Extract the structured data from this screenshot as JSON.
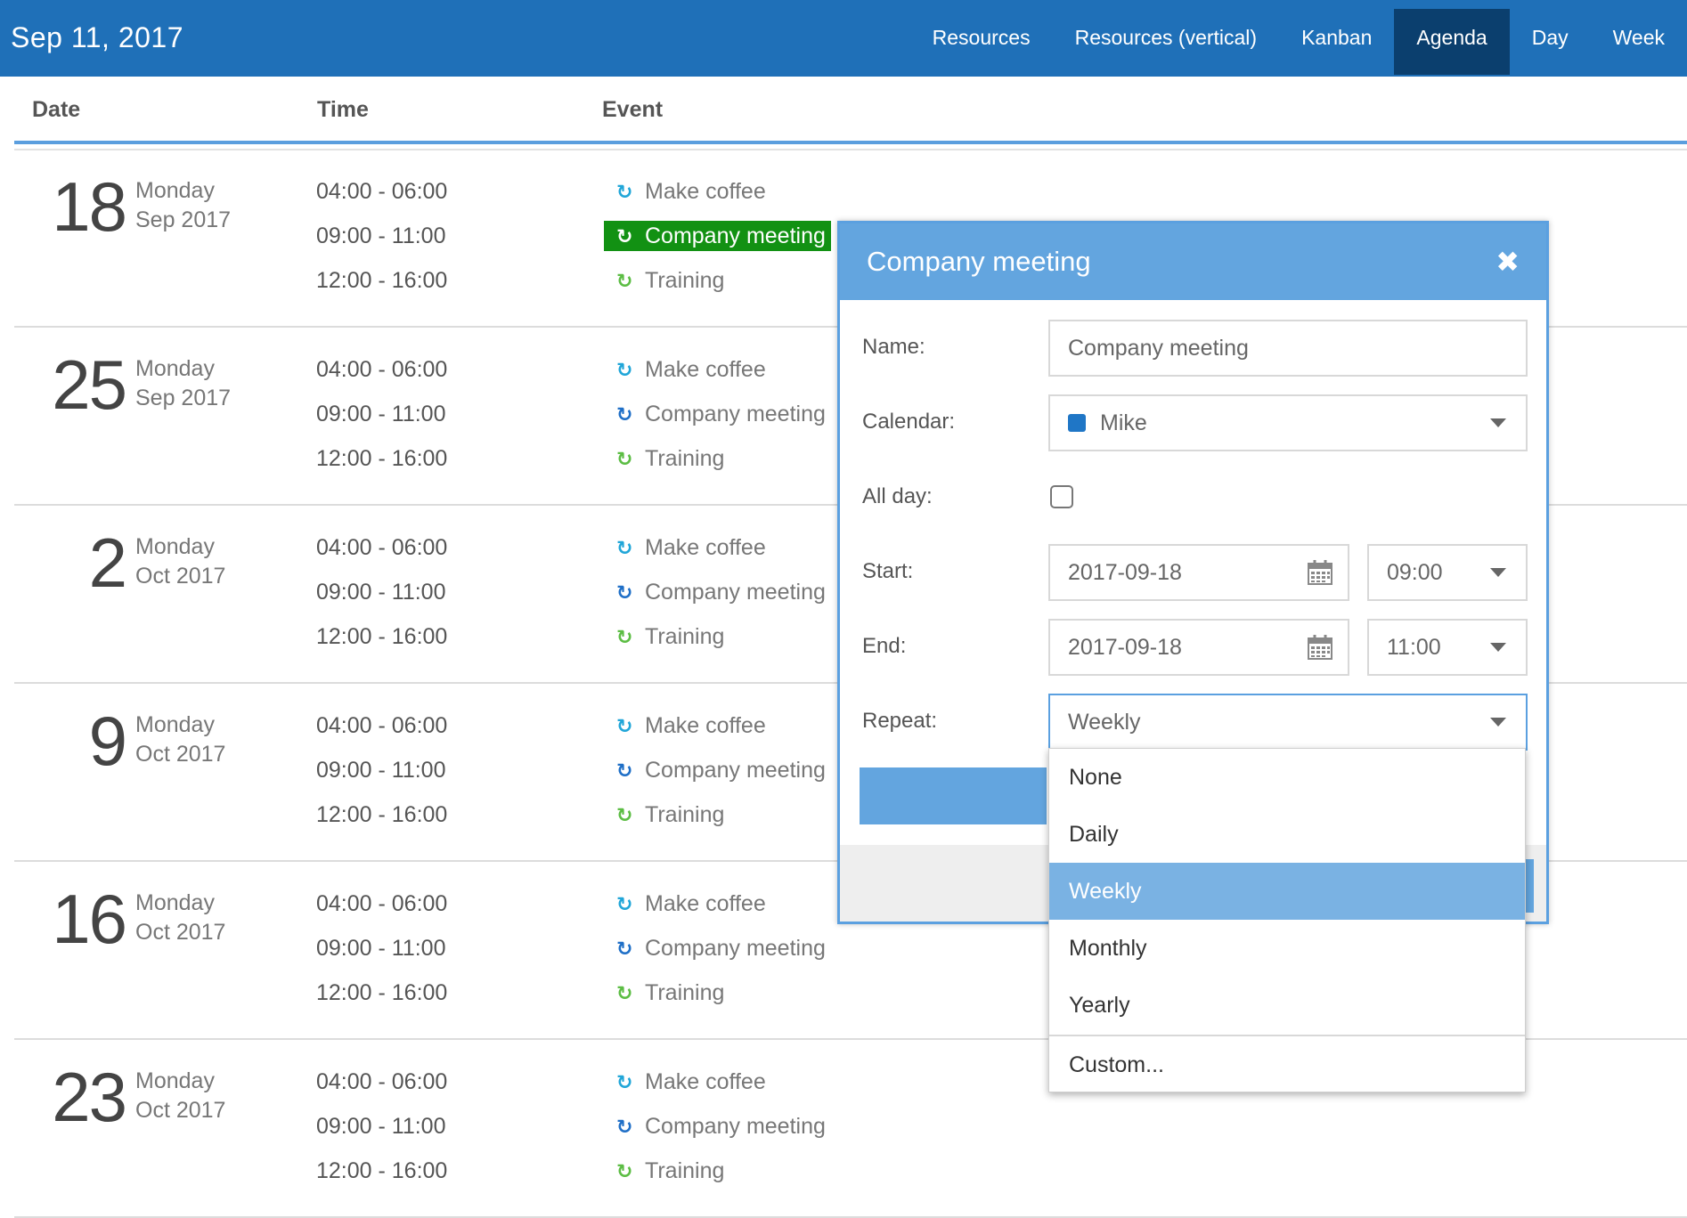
{
  "header": {
    "date": "Sep 11, 2017",
    "tabs": [
      {
        "label": "Resources",
        "active": false
      },
      {
        "label": "Resources (vertical)",
        "active": false
      },
      {
        "label": "Kanban",
        "active": false
      },
      {
        "label": "Agenda",
        "active": true
      },
      {
        "label": "Day",
        "active": false
      },
      {
        "label": "Week",
        "active": false
      }
    ]
  },
  "table": {
    "columns": [
      "Date",
      "Time",
      "Event"
    ]
  },
  "days": [
    {
      "num": "18",
      "weekday": "Monday",
      "month": "Sep 2017"
    },
    {
      "num": "25",
      "weekday": "Monday",
      "month": "Sep 2017"
    },
    {
      "num": "2",
      "weekday": "Monday",
      "month": "Oct 2017"
    },
    {
      "num": "9",
      "weekday": "Monday",
      "month": "Oct 2017"
    },
    {
      "num": "16",
      "weekday": "Monday",
      "month": "Oct 2017"
    },
    {
      "num": "23",
      "weekday": "Monday",
      "month": "Oct 2017"
    }
  ],
  "events": [
    {
      "time": "04:00 - 06:00",
      "title": "Make coffee",
      "color": "#21a6d8"
    },
    {
      "time": "09:00 - 11:00",
      "title": "Company meeting",
      "color": "#1f6fc7"
    },
    {
      "time": "12:00 - 16:00",
      "title": "Training",
      "color": "#5cbd44"
    }
  ],
  "selected_event_color": "#129113",
  "dialog": {
    "title": "Company meeting",
    "close_icon": "close-icon",
    "labels": {
      "name": "Name:",
      "calendar": "Calendar:",
      "allday": "All day:",
      "start": "Start:",
      "end": "End:",
      "repeat": "Repeat:"
    },
    "name_value": "Company meeting",
    "calendar_value": "Mike",
    "calendar_color": "#1f76c6",
    "start_date": "2017-09-18",
    "start_time": "09:00",
    "end_date": "2017-09-18",
    "end_time": "11:00",
    "repeat_value": "Weekly",
    "allday_checked": false
  },
  "repeat_options": [
    "None",
    "Daily",
    "Weekly",
    "Monthly",
    "Yearly",
    "Custom..."
  ],
  "repeat_selected": "Weekly",
  "colors": {
    "topbar": "#1f70b8",
    "active_tab": "#0b3f6e",
    "dialog_header": "#63a5df",
    "option_selected": "#7ab2e3"
  }
}
